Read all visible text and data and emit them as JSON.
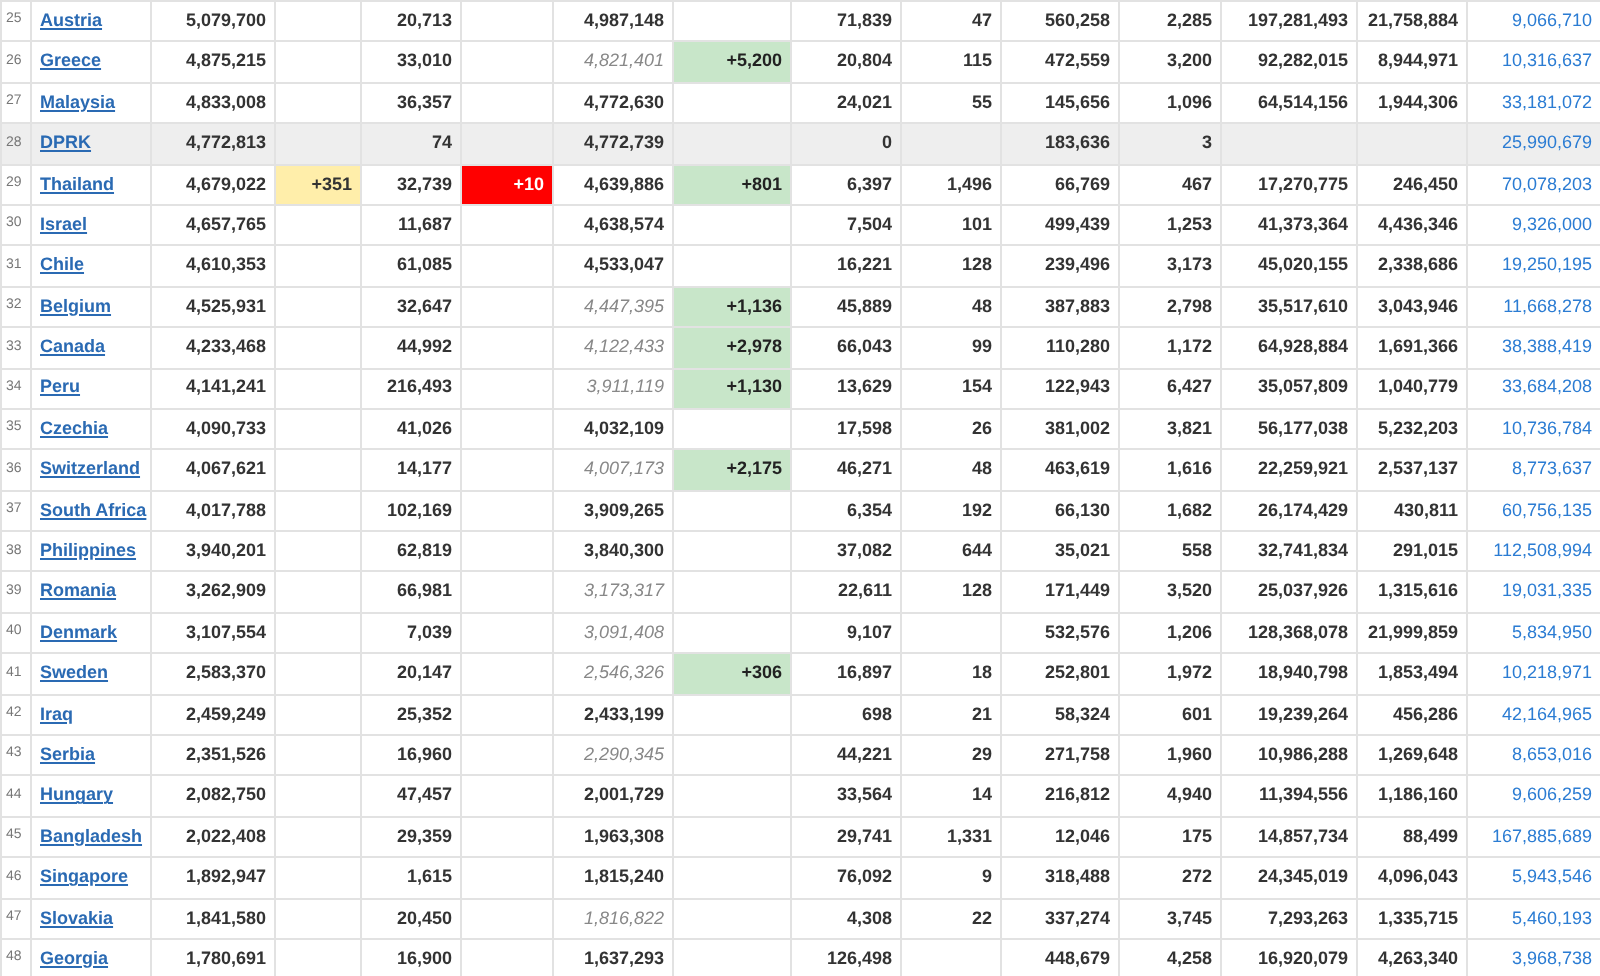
{
  "table": {
    "rows": [
      {
        "rank": "25",
        "country": "Austria",
        "shaded": false,
        "estimated": false,
        "cells": [
          "5,079,700",
          null,
          "20,713",
          null,
          "4,987,148",
          null,
          "71,839",
          "47",
          "560,258",
          "2,285",
          "197,281,493",
          "21,758,884",
          "9,066,710"
        ]
      },
      {
        "rank": "26",
        "country": "Greece",
        "shaded": false,
        "estimated": true,
        "cells": [
          "4,875,215",
          null,
          "33,010",
          null,
          "4,821,401",
          "+5,200",
          "20,804",
          "115",
          "472,559",
          "3,200",
          "92,282,015",
          "8,944,971",
          "10,316,637"
        ]
      },
      {
        "rank": "27",
        "country": "Malaysia",
        "shaded": false,
        "estimated": false,
        "cells": [
          "4,833,008",
          null,
          "36,357",
          null,
          "4,772,630",
          null,
          "24,021",
          "55",
          "145,656",
          "1,096",
          "64,514,156",
          "1,944,306",
          "33,181,072"
        ]
      },
      {
        "rank": "28",
        "country": "DPRK",
        "shaded": true,
        "estimated": false,
        "cells": [
          "4,772,813",
          null,
          "74",
          null,
          "4,772,739",
          null,
          "0",
          null,
          "183,636",
          "3",
          null,
          null,
          "25,990,679"
        ]
      },
      {
        "rank": "29",
        "country": "Thailand",
        "shaded": false,
        "estimated": false,
        "cells": [
          "4,679,022",
          "+351",
          "32,739",
          "+10",
          "4,639,886",
          "+801",
          "6,397",
          "1,496",
          "66,769",
          "467",
          "17,270,775",
          "246,450",
          "70,078,203"
        ]
      },
      {
        "rank": "30",
        "country": "Israel",
        "shaded": false,
        "estimated": false,
        "cells": [
          "4,657,765",
          null,
          "11,687",
          null,
          "4,638,574",
          null,
          "7,504",
          "101",
          "499,439",
          "1,253",
          "41,373,364",
          "4,436,346",
          "9,326,000"
        ]
      },
      {
        "rank": "31",
        "country": "Chile",
        "shaded": false,
        "estimated": false,
        "cells": [
          "4,610,353",
          null,
          "61,085",
          null,
          "4,533,047",
          null,
          "16,221",
          "128",
          "239,496",
          "3,173",
          "45,020,155",
          "2,338,686",
          "19,250,195"
        ]
      },
      {
        "rank": "32",
        "country": "Belgium",
        "shaded": false,
        "estimated": true,
        "cells": [
          "4,525,931",
          null,
          "32,647",
          null,
          "4,447,395",
          "+1,136",
          "45,889",
          "48",
          "387,883",
          "2,798",
          "35,517,610",
          "3,043,946",
          "11,668,278"
        ]
      },
      {
        "rank": "33",
        "country": "Canada",
        "shaded": false,
        "estimated": true,
        "cells": [
          "4,233,468",
          null,
          "44,992",
          null,
          "4,122,433",
          "+2,978",
          "66,043",
          "99",
          "110,280",
          "1,172",
          "64,928,884",
          "1,691,366",
          "38,388,419"
        ]
      },
      {
        "rank": "34",
        "country": "Peru",
        "shaded": false,
        "estimated": true,
        "cells": [
          "4,141,241",
          null,
          "216,493",
          null,
          "3,911,119",
          "+1,130",
          "13,629",
          "154",
          "122,943",
          "6,427",
          "35,057,809",
          "1,040,779",
          "33,684,208"
        ]
      },
      {
        "rank": "35",
        "country": "Czechia",
        "shaded": false,
        "estimated": false,
        "cells": [
          "4,090,733",
          null,
          "41,026",
          null,
          "4,032,109",
          null,
          "17,598",
          "26",
          "381,002",
          "3,821",
          "56,177,038",
          "5,232,203",
          "10,736,784"
        ]
      },
      {
        "rank": "36",
        "country": "Switzerland",
        "shaded": false,
        "estimated": true,
        "cells": [
          "4,067,621",
          null,
          "14,177",
          null,
          "4,007,173",
          "+2,175",
          "46,271",
          "48",
          "463,619",
          "1,616",
          "22,259,921",
          "2,537,137",
          "8,773,637"
        ]
      },
      {
        "rank": "37",
        "country": "South Africa",
        "shaded": false,
        "estimated": false,
        "cells": [
          "4,017,788",
          null,
          "102,169",
          null,
          "3,909,265",
          null,
          "6,354",
          "192",
          "66,130",
          "1,682",
          "26,174,429",
          "430,811",
          "60,756,135"
        ]
      },
      {
        "rank": "38",
        "country": "Philippines",
        "shaded": false,
        "estimated": false,
        "cells": [
          "3,940,201",
          null,
          "62,819",
          null,
          "3,840,300",
          null,
          "37,082",
          "644",
          "35,021",
          "558",
          "32,741,834",
          "291,015",
          "112,508,994"
        ]
      },
      {
        "rank": "39",
        "country": "Romania",
        "shaded": false,
        "estimated": true,
        "cells": [
          "3,262,909",
          null,
          "66,981",
          null,
          "3,173,317",
          null,
          "22,611",
          "128",
          "171,449",
          "3,520",
          "25,037,926",
          "1,315,616",
          "19,031,335"
        ]
      },
      {
        "rank": "40",
        "country": "Denmark",
        "shaded": false,
        "estimated": true,
        "cells": [
          "3,107,554",
          null,
          "7,039",
          null,
          "3,091,408",
          null,
          "9,107",
          null,
          "532,576",
          "1,206",
          "128,368,078",
          "21,999,859",
          "5,834,950"
        ]
      },
      {
        "rank": "41",
        "country": "Sweden",
        "shaded": false,
        "estimated": true,
        "cells": [
          "2,583,370",
          null,
          "20,147",
          null,
          "2,546,326",
          "+306",
          "16,897",
          "18",
          "252,801",
          "1,972",
          "18,940,798",
          "1,853,494",
          "10,218,971"
        ]
      },
      {
        "rank": "42",
        "country": "Iraq",
        "shaded": false,
        "estimated": false,
        "cells": [
          "2,459,249",
          null,
          "25,352",
          null,
          "2,433,199",
          null,
          "698",
          "21",
          "58,324",
          "601",
          "19,239,264",
          "456,286",
          "42,164,965"
        ]
      },
      {
        "rank": "43",
        "country": "Serbia",
        "shaded": false,
        "estimated": true,
        "cells": [
          "2,351,526",
          null,
          "16,960",
          null,
          "2,290,345",
          null,
          "44,221",
          "29",
          "271,758",
          "1,960",
          "10,986,288",
          "1,269,648",
          "8,653,016"
        ]
      },
      {
        "rank": "44",
        "country": "Hungary",
        "shaded": false,
        "estimated": false,
        "cells": [
          "2,082,750",
          null,
          "47,457",
          null,
          "2,001,729",
          null,
          "33,564",
          "14",
          "216,812",
          "4,940",
          "11,394,556",
          "1,186,160",
          "9,606,259"
        ]
      },
      {
        "rank": "45",
        "country": "Bangladesh",
        "shaded": false,
        "estimated": false,
        "cells": [
          "2,022,408",
          null,
          "29,359",
          null,
          "1,963,308",
          null,
          "29,741",
          "1,331",
          "12,046",
          "175",
          "14,857,734",
          "88,499",
          "167,885,689"
        ]
      },
      {
        "rank": "46",
        "country": "Singapore",
        "shaded": false,
        "estimated": false,
        "cells": [
          "1,892,947",
          null,
          "1,615",
          null,
          "1,815,240",
          null,
          "76,092",
          "9",
          "318,488",
          "272",
          "24,345,019",
          "4,096,043",
          "5,943,546"
        ]
      },
      {
        "rank": "47",
        "country": "Slovakia",
        "shaded": false,
        "estimated": true,
        "cells": [
          "1,841,580",
          null,
          "20,450",
          null,
          "1,816,822",
          null,
          "4,308",
          "22",
          "337,274",
          "3,745",
          "7,293,263",
          "1,335,715",
          "5,460,193"
        ]
      },
      {
        "rank": "48",
        "country": "Georgia",
        "shaded": false,
        "estimated": false,
        "cells": [
          "1,780,691",
          null,
          "16,900",
          null,
          "1,637,293",
          null,
          "126,498",
          null,
          "448,679",
          "4,258",
          "16,920,079",
          "4,263,340",
          "3,968,738"
        ]
      }
    ]
  }
}
